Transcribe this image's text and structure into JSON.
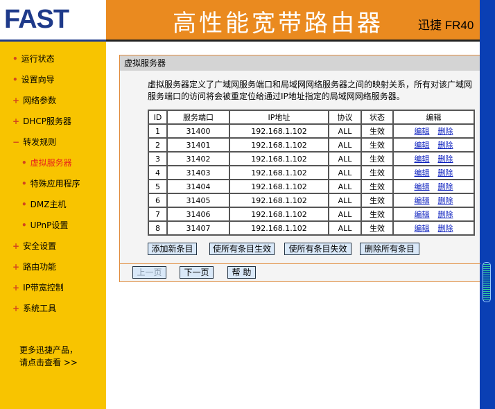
{
  "header": {
    "logo": "FAST",
    "title": "高性能宽带路由器",
    "model": "迅捷 FR40"
  },
  "sidebar": {
    "items": [
      {
        "label": "运行状态",
        "bullet": "•"
      },
      {
        "label": "设置向导",
        "bullet": "•"
      },
      {
        "label": "网络参数",
        "bullet": "+"
      },
      {
        "label": "DHCP服务器",
        "bullet": "+"
      },
      {
        "label": "转发规则",
        "bullet": "−"
      },
      {
        "label": "虚拟服务器",
        "bullet": "•"
      },
      {
        "label": "特殊应用程序",
        "bullet": "•"
      },
      {
        "label": "DMZ主机",
        "bullet": "•"
      },
      {
        "label": "UPnP设置",
        "bullet": "•"
      },
      {
        "label": "安全设置",
        "bullet": "+"
      },
      {
        "label": "路由功能",
        "bullet": "+"
      },
      {
        "label": "IP带宽控制",
        "bullet": "+"
      },
      {
        "label": "系统工具",
        "bullet": "+"
      }
    ],
    "more1": "更多迅捷产品，",
    "more2": "请点击查看 >>"
  },
  "panel": {
    "title": "虚拟服务器",
    "desc": "虚拟服务器定义了广域网服务端口和局域网网络服务器之间的映射关系，所有对该广域网服务端口的访问将会被重定位给通过IP地址指定的局域网网络服务器。",
    "headers": [
      "ID",
      "服务端口",
      "IP地址",
      "协议",
      "状态",
      "编辑"
    ],
    "rows": [
      [
        "1",
        "31400",
        "192.168.1.102",
        "ALL",
        "生效"
      ],
      [
        "2",
        "31401",
        "192.168.1.102",
        "ALL",
        "生效"
      ],
      [
        "3",
        "31402",
        "192.168.1.102",
        "ALL",
        "生效"
      ],
      [
        "4",
        "31403",
        "192.168.1.102",
        "ALL",
        "生效"
      ],
      [
        "5",
        "31404",
        "192.168.1.102",
        "ALL",
        "生效"
      ],
      [
        "6",
        "31405",
        "192.168.1.102",
        "ALL",
        "生效"
      ],
      [
        "7",
        "31406",
        "192.168.1.102",
        "ALL",
        "生效"
      ],
      [
        "8",
        "31407",
        "192.168.1.102",
        "ALL",
        "生效"
      ]
    ],
    "edit": "编辑",
    "delete": "删除",
    "buttons": [
      "添加新条目",
      "使所有条目生效",
      "使所有条目失效",
      "删除所有条目"
    ],
    "nav": [
      "上一页",
      "下一页",
      "帮 助"
    ]
  }
}
